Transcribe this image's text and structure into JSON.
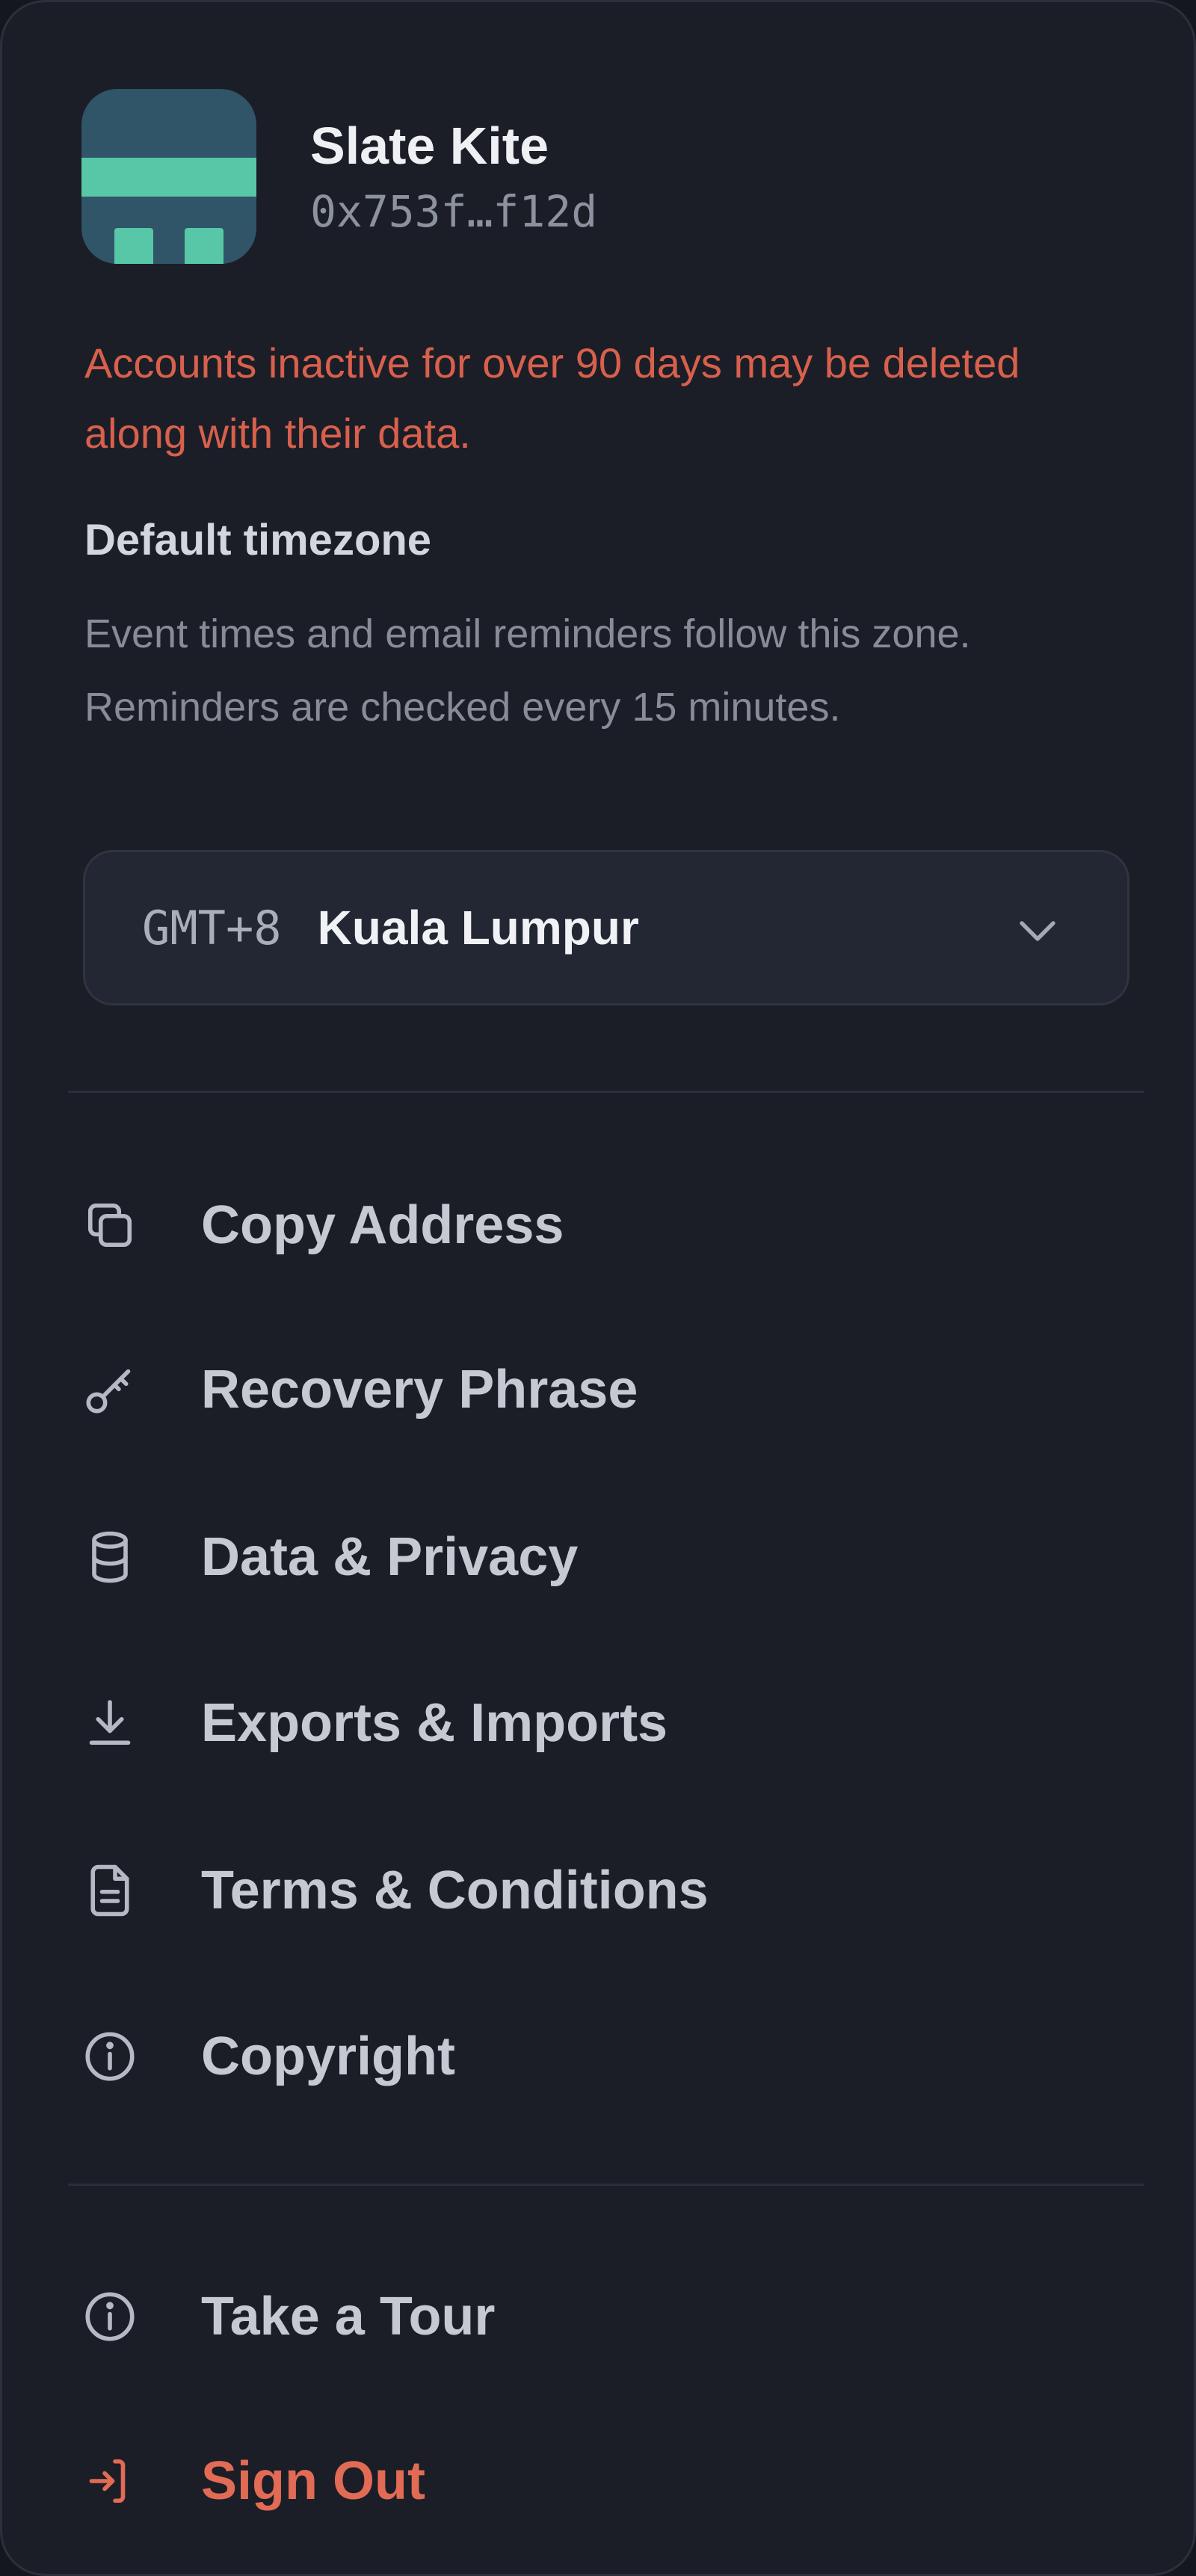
{
  "account": {
    "name": "Slate Kite",
    "address": "0x753f…f12d"
  },
  "warning_text": "Accounts inactive for over 90 days may be deleted along with their data.",
  "timezone": {
    "title": "Default timezone",
    "description": "Event times and email reminders follow this zone. Reminders are checked every 15 minutes.",
    "selected_offset": "GMT+8",
    "selected_city": "Kuala Lumpur"
  },
  "menu": {
    "items": [
      {
        "label": "Copy Address",
        "icon": "copy-icon"
      },
      {
        "label": "Recovery Phrase",
        "icon": "key-icon"
      },
      {
        "label": "Data & Privacy",
        "icon": "database-icon"
      },
      {
        "label": "Exports & Imports",
        "icon": "download-icon"
      },
      {
        "label": "Terms & Conditions",
        "icon": "document-icon"
      },
      {
        "label": "Copyright",
        "icon": "info-icon"
      }
    ],
    "secondary": [
      {
        "label": "Take a Tour",
        "icon": "info-icon"
      },
      {
        "label": "Sign Out",
        "icon": "sign-out-icon"
      }
    ]
  },
  "colors": {
    "panel_bg": "#1b1e27",
    "avatar_bg": "#305468",
    "avatar_accent": "#57c7a7",
    "warning": "#d8604c",
    "danger": "#e26b55"
  }
}
